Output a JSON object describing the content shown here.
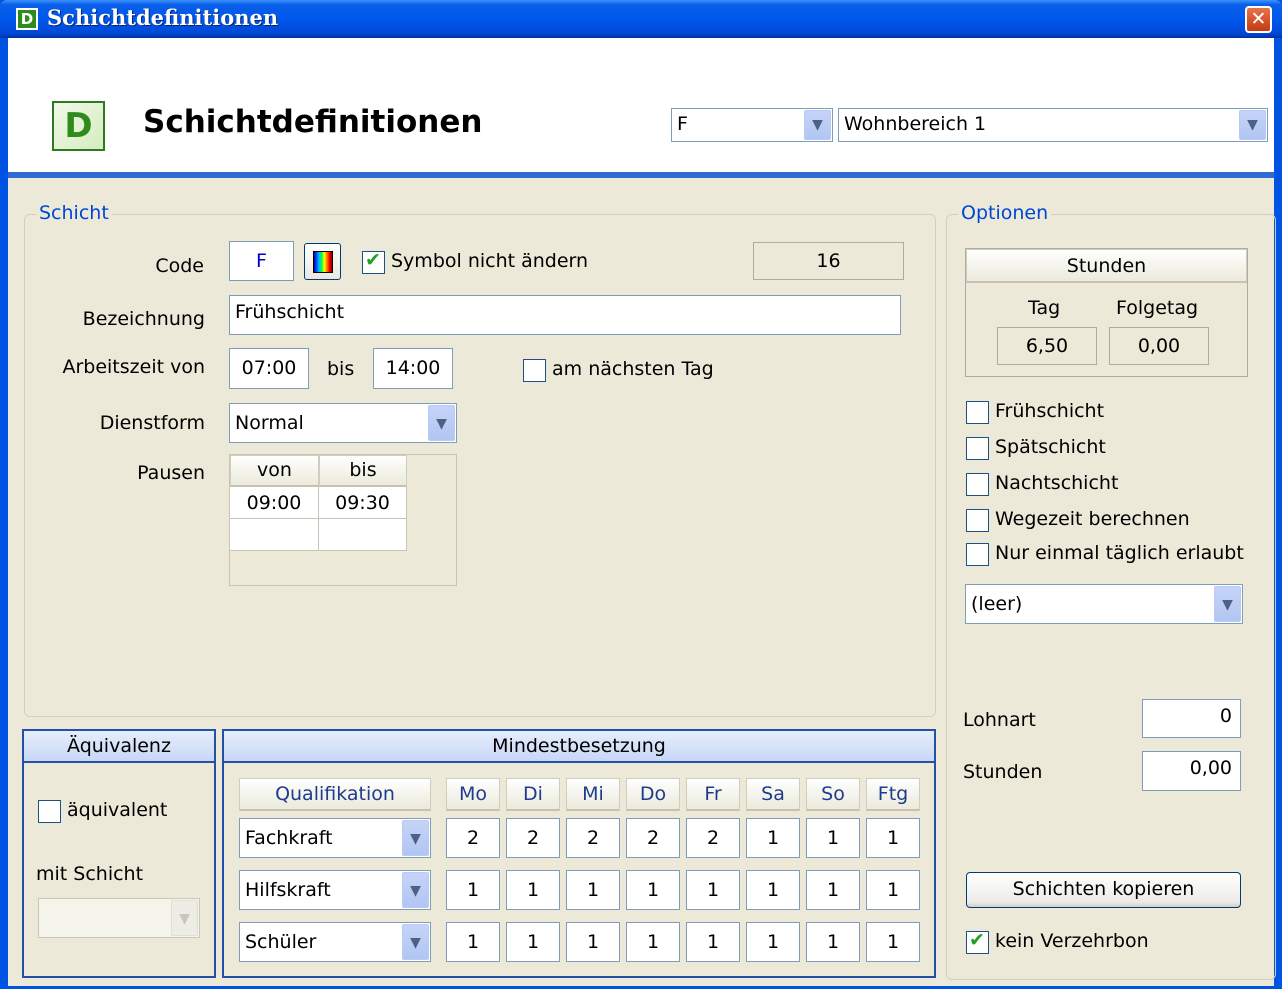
{
  "window": {
    "title": "Schichtdefinitionen",
    "icon_letter": "D",
    "close_glyph": "✕"
  },
  "header": {
    "title": "Schichtdefinitionen",
    "icon_letter": "D",
    "code_combo": "F",
    "area_combo": "Wohnbereich 1"
  },
  "schicht": {
    "group_label": "Schicht",
    "code_label": "Code",
    "code_value": "F",
    "symbol_checkbox_label": "Symbol nicht ändern",
    "symbol_checked": true,
    "number_value": "16",
    "bezeichnung_label": "Bezeichnung",
    "bezeichnung_value": "Frühschicht",
    "arbeitszeit_label": "Arbeitszeit von",
    "von_value": "07:00",
    "bis_label": "bis",
    "bis_value": "14:00",
    "next_day_label": "am nächsten Tag",
    "dienstform_label": "Dienstform",
    "dienstform_value": "Normal",
    "pausen_label": "Pausen",
    "pausen_headers": [
      "von",
      "bis"
    ],
    "pausen_rows": [
      [
        "09:00",
        "09:30"
      ],
      [
        "",
        ""
      ]
    ]
  },
  "optionen": {
    "group_label": "Optionen",
    "stunden_header": "Stunden",
    "tag_label": "Tag",
    "tag_value": "6,50",
    "folgetag_label": "Folgetag",
    "folgetag_value": "0,00",
    "checkboxes": [
      {
        "label": "Frühschicht",
        "checked": false
      },
      {
        "label": "Spätschicht",
        "checked": false
      },
      {
        "label": "Nachtschicht",
        "checked": false
      },
      {
        "label": "Wegezeit berechnen",
        "checked": false
      },
      {
        "label": "Nur einmal täglich erlaubt",
        "checked": false
      }
    ],
    "combo_value": "(leer)",
    "lohnart_label": "Lohnart",
    "lohnart_value": "0",
    "stunden_label": "Stunden",
    "stunden_value": "0,00",
    "copy_button": "Schichten kopieren",
    "verzehrbon_label": "kein Verzehrbon",
    "verzehrbon_checked": true
  },
  "aequivalenz": {
    "header": "Äquivalenz",
    "checkbox_label": "äquivalent",
    "mit_schicht_label": "mit Schicht",
    "mit_schicht_value": ""
  },
  "mindestbesetzung": {
    "header": "Mindestbesetzung",
    "qualifikation_header": "Qualifikation",
    "days": [
      "Mo",
      "Di",
      "Mi",
      "Do",
      "Fr",
      "Sa",
      "So",
      "Ftg"
    ],
    "rows": [
      {
        "qualifikation": "Fachkraft",
        "values": [
          "2",
          "2",
          "2",
          "2",
          "2",
          "1",
          "1",
          "1"
        ]
      },
      {
        "qualifikation": "Hilfskraft",
        "values": [
          "1",
          "1",
          "1",
          "1",
          "1",
          "1",
          "1",
          "1"
        ]
      },
      {
        "qualifikation": "Schüler",
        "values": [
          "1",
          "1",
          "1",
          "1",
          "1",
          "1",
          "1",
          "1"
        ]
      }
    ]
  }
}
